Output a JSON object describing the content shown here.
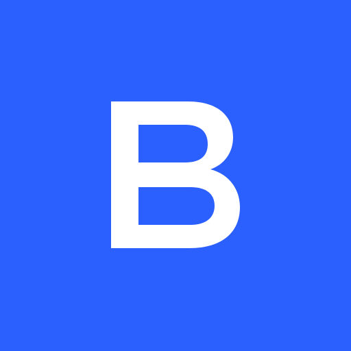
{
  "logo": {
    "letter": "B",
    "background_color": "#2b5ffe",
    "letter_color": "#ffffff"
  }
}
